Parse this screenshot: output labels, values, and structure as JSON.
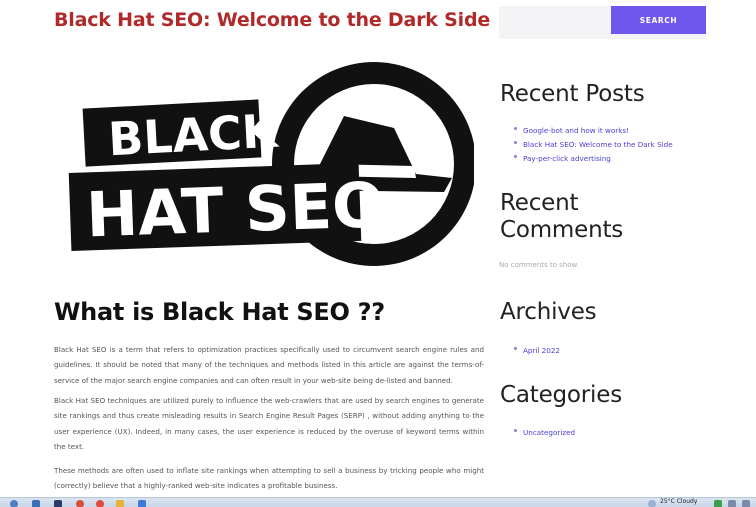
{
  "post": {
    "title": "Black Hat SEO: Welcome to the Dark Side",
    "logo_text_line1": "BLACK",
    "logo_text_line2": "HAT SEO",
    "heading": "What is Black Hat SEO ??",
    "paragraphs": [
      "Black Hat SEO is a term that refers to optimization practices specifically used to circumvent search engine rules and guidelines. It should be noted that many of the techniques and methods listed in this article are against the terms-of-service of the major search engine companies and can often result in your web-site being de-listed and banned.",
      "Black Hat SEO techniques are utilized purely to influence the web-crawlers that are used by search engines to generate site rankings and thus create misleading results in Search Engine Result Pages (SERP) , without adding anything to the user experience (UX). Indeed, in many cases, the user experience is reduced by the overuse of keyword terms within the text.",
      "These methods are often used to inflate site rankings when attempting to sell a business by tricking people who might (correctly) believe that a highly-ranked web-site indicates a profitable business."
    ]
  },
  "search": {
    "placeholder": "",
    "button_label": "SEARCH"
  },
  "sidebar": {
    "recent_posts": {
      "title": "Recent Posts",
      "items": [
        "Google-bot and how it works!",
        "Black Hat SEO: Welcome to the Dark Side",
        "Pay-per-click advertising"
      ]
    },
    "recent_comments": {
      "title": "Recent Comments",
      "empty_text": "No comments to show."
    },
    "archives": {
      "title": "Archives",
      "items": [
        "April 2022"
      ]
    },
    "categories": {
      "title": "Categories",
      "items": [
        "Uncategorized"
      ]
    }
  },
  "taskbar": {
    "tray_text": "25°C Cloudy"
  },
  "colors": {
    "title_red": "#b12a2a",
    "accent_purple": "#6f56ec",
    "link_blue": "#4a3fd6"
  }
}
